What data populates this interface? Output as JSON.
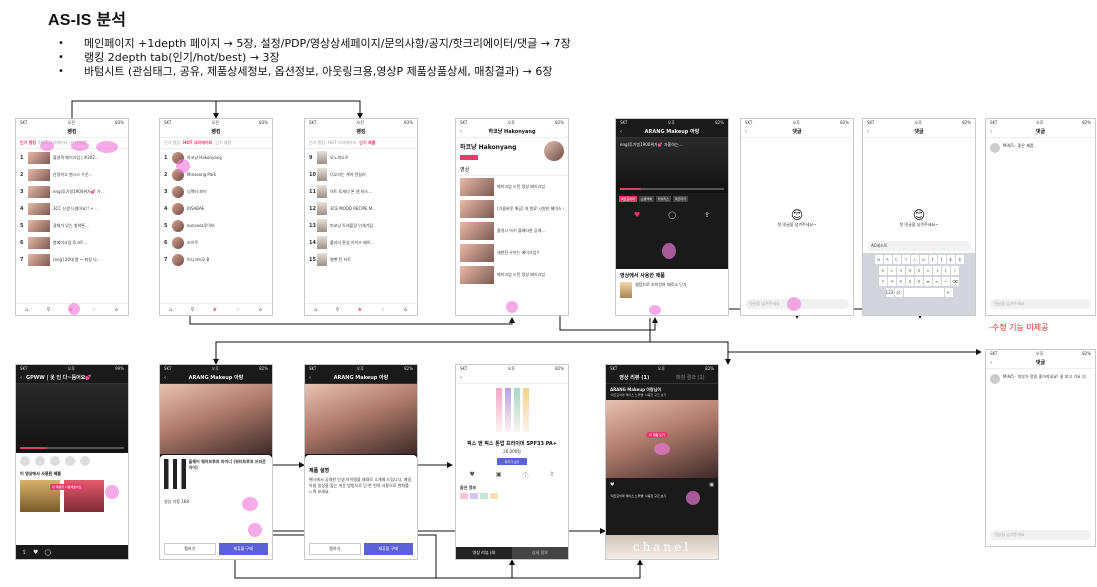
{
  "title": "AS-IS 분석",
  "bullets": [
    "메인페이지 +1depth 페이지 → 5장, 설정/PDP/영상상세페이지/문의사항/공지/핫크리에이터/댓글 → 7장",
    "랭킹 2depth tab(인기/hot/best) → 3장",
    "바텀시트 (관심태그, 공유, 제품상세정보, 옵션정보, 아웃링크용,영상P 제품상품상세, 매칭결과) → 6장"
  ],
  "note": "-수정 기능 미제공",
  "screens": {
    "ranking": {
      "header": "랭킹",
      "tabs": [
        "인기 랭킹",
        "HOT 크리에이터",
        "인기 제품"
      ],
      "items": [
        "올영픽 메이크업 | #202…",
        "안경끼고 팬시스 수준…",
        "eng)투기방1900위가💕 가…",
        "3CC 신생 나렸어요!! + …",
        "광채가 있는 발색톤…",
        "봄메이크업 토크트…",
        "[eng] 20대 봄 ~ 화장 다…"
      ]
    },
    "creator": {
      "header": "랭킹",
      "items": [
        "하코냥 Hakonyang",
        "Minsoong Park",
        "디렉터 파이",
        "RISABAE",
        "eunseoz루이비",
        "조이쭈",
        "띠니크리오 B"
      ]
    },
    "product": {
      "header": "랭킹",
      "items": [
        "모노피오르",
        "디오리는 케어 컨실러",
        "히트 토게더 톤 엔 마스…",
        "3CE MOOD RECIPE M…",
        "피코닝 토레플링 인쇄기팁",
        "롤리더 톤업 아이즈 베이…",
        "벨벳 틴 티트"
      ]
    },
    "profile": {
      "name": "하코냥 Hakonyang",
      "section": "영상",
      "videos": [
        "메이크업 드린 정성 메이크업",
        "[가을바웃 해공] 쉬 향료 시원한 페이스 하이라이트",
        "올영시 아기 플래터한 공계…",
        "세련된 우아는 메이크업!!"
      ]
    },
    "player": {
      "channel": "ARANG Makeup 아랑",
      "caption": "eng)투기방1900위가💕 가흥하는…",
      "chips": [
        "피트모아마",
        "쇼핑백에",
        "타이리스",
        "제코타카"
      ],
      "section": "영상에서 사용한 제품",
      "product": "셀럽으로 조미랑하 매로소 단가"
    },
    "comment_empty": {
      "header": "댓글",
      "empty": "첫 댓글을 남겨주세요~",
      "input": "댓글을 남겨주세요"
    },
    "comment_typing": {
      "header": "댓글",
      "empty": "첫 댓글을 남겨주세요~",
      "typed": "AC테스트"
    },
    "comment_list": {
      "header": "댓글",
      "comment": "Mihi5 · 좋은 제품",
      "input": "댓글을 남겨주세요"
    },
    "comment_list2": {
      "header": "댓글",
      "comment": "Mihi5 · 피부가 정말 좋아지네요! 잘 보고 가요 ☺",
      "input": "댓글을 남겨주세요"
    },
    "live": {
      "header": "GPWW | 옷 인 다~듬어요💕",
      "section": "이 영상에서 사용된 제품",
      "badge": "이 제품을 사용해봤어요"
    },
    "sheet1": {
      "channel": "ARANG Makeup 아랑",
      "product": "올웨어 웨어프루프 라이너 (워터프루프 브라운 아이)",
      "section": "영상 이용 168",
      "btn_a": "찜하기",
      "btn_b": "제휴몰 구매"
    },
    "sheet2": {
      "channel": "ARANG Makeup 아랑",
      "section": "제품 설명",
      "body": "팬시에서 공개한 인생 아이템을 제대로 소개해 드립니다. 매일 아침 일상을 돕는 쉬운 방법으로 단 한 번의 사용으로 변화를 느껴 보세요.",
      "btn_a": "찜하기",
      "btn_b": "제휴몰 구매"
    },
    "pdp": {
      "product": "픽스 앤 픽스 톤업 프라이머 SPF33 PA+",
      "price": "26,000원",
      "btn": "최저가 보기",
      "section": "옵션 정보",
      "tabs": [
        "영상 리뷰 (4)",
        "상세 정보",
        "제품 정보",
        "공유"
      ]
    },
    "matching": {
      "tabs": [
        "영상 리뷰 (1)",
        "매칭 결과 (1)"
      ],
      "creator": "ARANG Makeup 아랑님이",
      "desc": "'피트모아마 레이스 노루밸' 사용한 구간 보기",
      "badge": "이 제품 보기",
      "bottom": "chanel"
    }
  }
}
